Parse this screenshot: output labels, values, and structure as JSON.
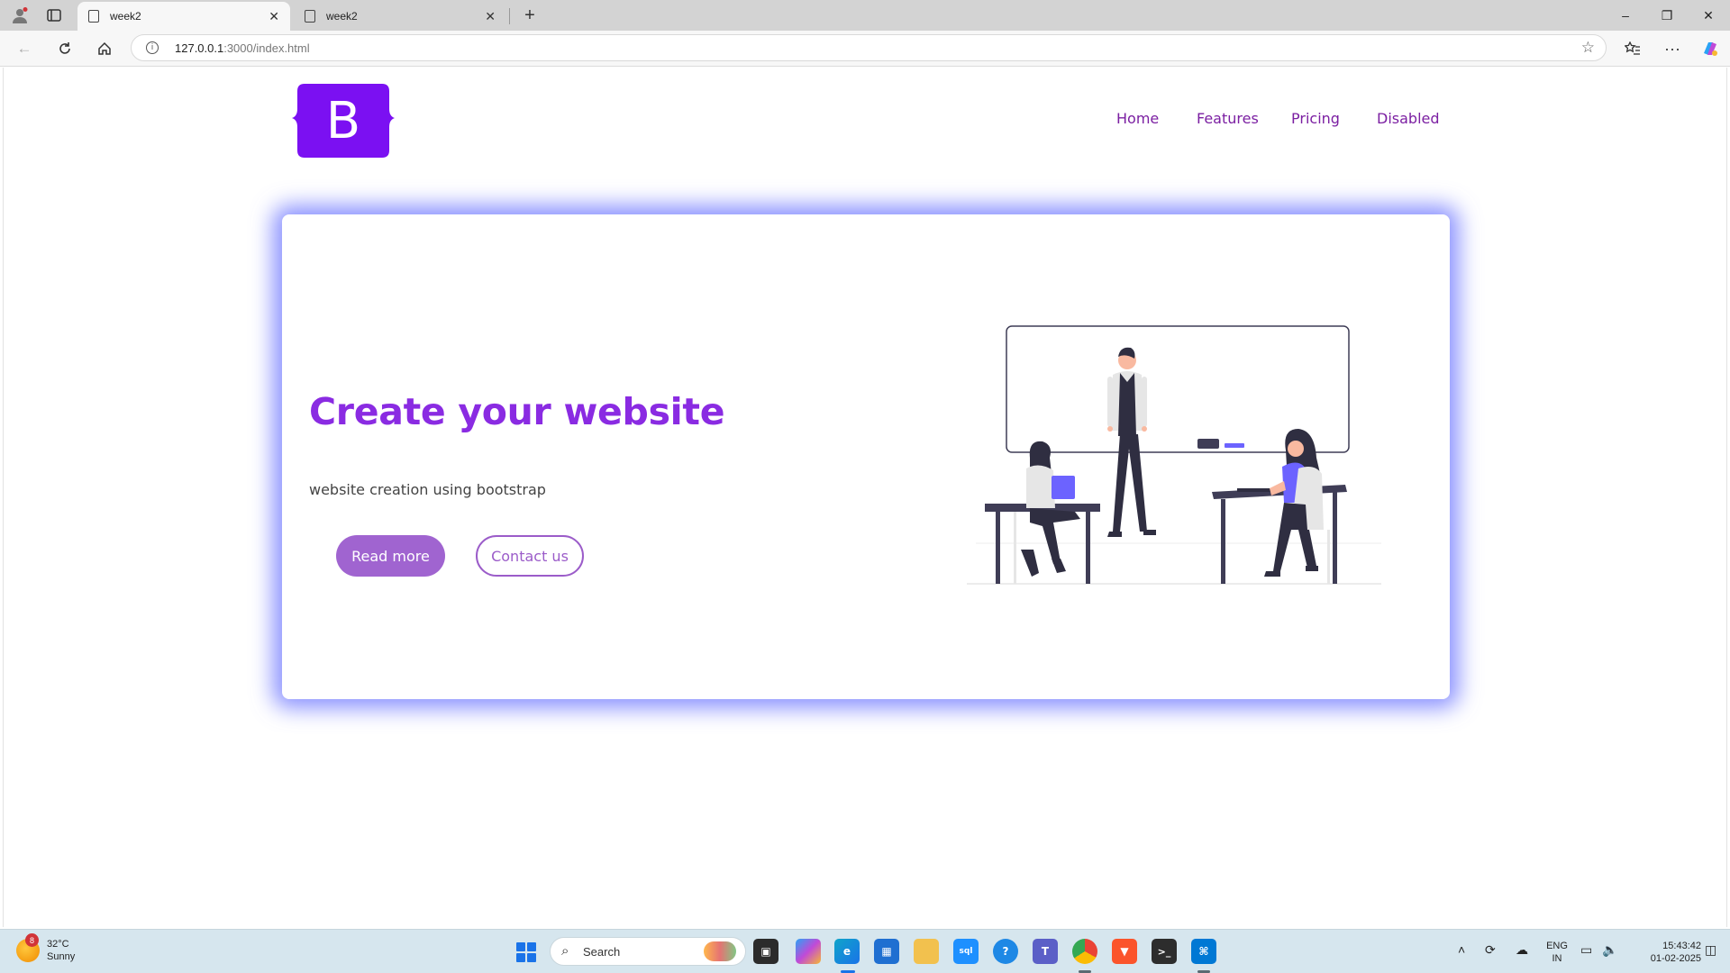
{
  "browser": {
    "tabs": [
      {
        "title": "week2",
        "active": true
      },
      {
        "title": "week2",
        "active": false
      }
    ],
    "new_tab": "+",
    "url_host": "127.0.0.1",
    "url_path": ":3000/index.html",
    "window_controls": {
      "minimize": "–",
      "restore": "❐",
      "close": "✕"
    }
  },
  "site": {
    "logo_letter": "B",
    "nav": [
      {
        "label": "Home"
      },
      {
        "label": "Features"
      },
      {
        "label": "Pricing"
      },
      {
        "label": "Disabled"
      }
    ],
    "hero": {
      "title": "Create your website",
      "subtitle": "website creation using bootstrap",
      "primary_button": "Read more",
      "secondary_button": "Contact us"
    }
  },
  "taskbar": {
    "weather_temp": "32°C",
    "weather_cond": "Sunny",
    "weather_badge": "8",
    "search_label": "Search",
    "lang_line1": "ENG",
    "lang_line2": "IN",
    "time": "15:43:42",
    "date": "01-02-2025"
  },
  "colors": {
    "accent_purple": "#8a2be2",
    "nav_link": "#7b1fa2",
    "button_fill": "#a064d0",
    "card_glow": "#646eff",
    "logo_purple": "#7b10f2"
  }
}
